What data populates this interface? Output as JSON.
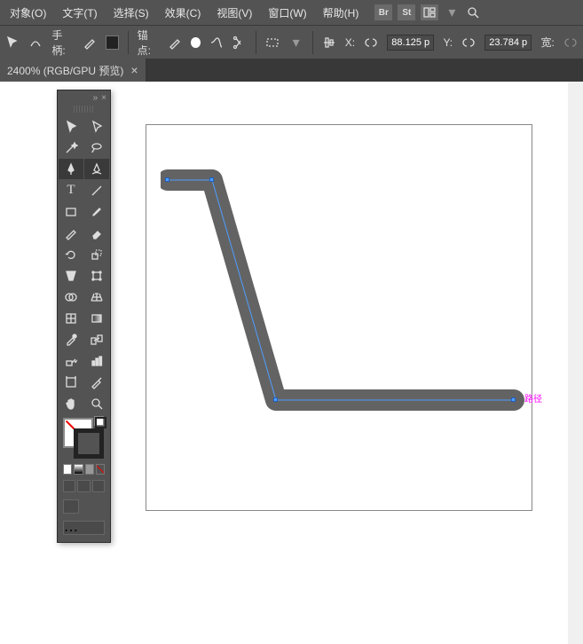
{
  "menus": {
    "object": "对象(O)",
    "text": "文字(T)",
    "select": "选择(S)",
    "effect": "效果(C)",
    "view": "视图(V)",
    "window": "窗口(W)",
    "help": "帮助(H)",
    "br": "Br",
    "st": "St"
  },
  "control": {
    "handle_label": "手柄:",
    "anchor_label": "锚点:",
    "x_label": "X:",
    "y_label": "Y:",
    "x_val": "88.125 p",
    "y_val": "23.784 p",
    "w_label": "宽:"
  },
  "tab": {
    "title": "2400% (RGB/GPU 预览)",
    "close": "×"
  },
  "panel": {
    "menu": "»",
    "close": "×"
  },
  "colors": {
    "fill": "#ffffff",
    "stroke": "#222222"
  },
  "path_label": "路径"
}
